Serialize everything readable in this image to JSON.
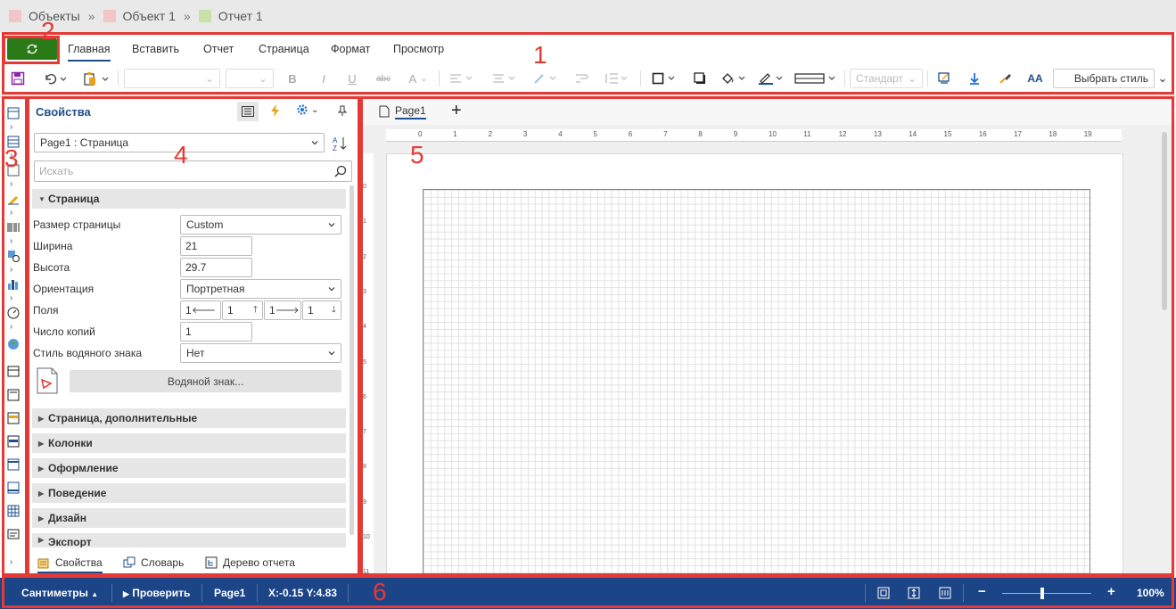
{
  "breadcrumb": {
    "items": [
      {
        "label": "Объекты",
        "color": "#f2c6c6"
      },
      {
        "label": "Объект 1",
        "color": "#f2c6c6"
      },
      {
        "label": "Отчет 1",
        "color": "#c9e0a8"
      }
    ],
    "separator": "»"
  },
  "ribbon": {
    "tabs": [
      "Главная",
      "Вставить",
      "Отчет",
      "Страница",
      "Формат",
      "Просмотр"
    ],
    "active_tab": "Главная",
    "style_combo": "Стандарт",
    "choose_style": "Выбрать стиль",
    "font_bold": "B",
    "font_italic": "I",
    "font_underline": "U",
    "font_strike": "abc",
    "font_color": "A",
    "text_format": "AA"
  },
  "annotations": [
    "1",
    "2",
    "3",
    "4",
    "5",
    "6"
  ],
  "properties_panel": {
    "title": "Свойства",
    "object_selector": "Page1 : Страница",
    "sort_label": "A Z",
    "search_placeholder": "Искать",
    "group_page": "Страница",
    "props": {
      "page_size_label": "Размер страницы",
      "page_size_value": "Custom",
      "width_label": "Ширина",
      "width_value": "21",
      "height_label": "Высота",
      "height_value": "29.7",
      "orientation_label": "Ориентация",
      "orientation_value": "Портретная",
      "margins_label": "Поля",
      "margins": [
        "1",
        "1",
        "1",
        "1"
      ],
      "copies_label": "Число копий",
      "copies_value": "1",
      "watermark_style_label": "Стиль водяного знака",
      "watermark_style_value": "Нет",
      "watermark_button": "Водяной знак..."
    },
    "groups": [
      "Страница, дополнительные",
      "Колонки",
      "Оформление",
      "Поведение",
      "Дизайн",
      "Экспорт"
    ],
    "bottom_tabs": [
      "Свойства",
      "Словарь",
      "Дерево отчета"
    ],
    "active_bottom_tab": "Свойства"
  },
  "designer": {
    "page_tab": "Page1",
    "add_tab": "+",
    "ruler_h": [
      "0",
      "1",
      "2",
      "3",
      "4",
      "5",
      "6",
      "7",
      "8",
      "9",
      "10",
      "11",
      "12",
      "13",
      "14",
      "15",
      "16",
      "17",
      "18",
      "19"
    ],
    "ruler_v": [
      "0",
      "1",
      "2",
      "3",
      "4",
      "5",
      "6",
      "7",
      "8",
      "9",
      "10",
      "11"
    ]
  },
  "statusbar": {
    "units": "Сантиметры",
    "check": "Проверить",
    "page": "Page1",
    "coords": "X:-0.15 Y:4.83",
    "zoom_minus": "−",
    "zoom_plus": "+",
    "zoom": "100%",
    "zoom_level": 0.45
  },
  "colors": {
    "accent": "#1f4e8c",
    "status_bg": "#1c4587",
    "annotation": "#e53935",
    "home_green": "#2a7a18"
  }
}
